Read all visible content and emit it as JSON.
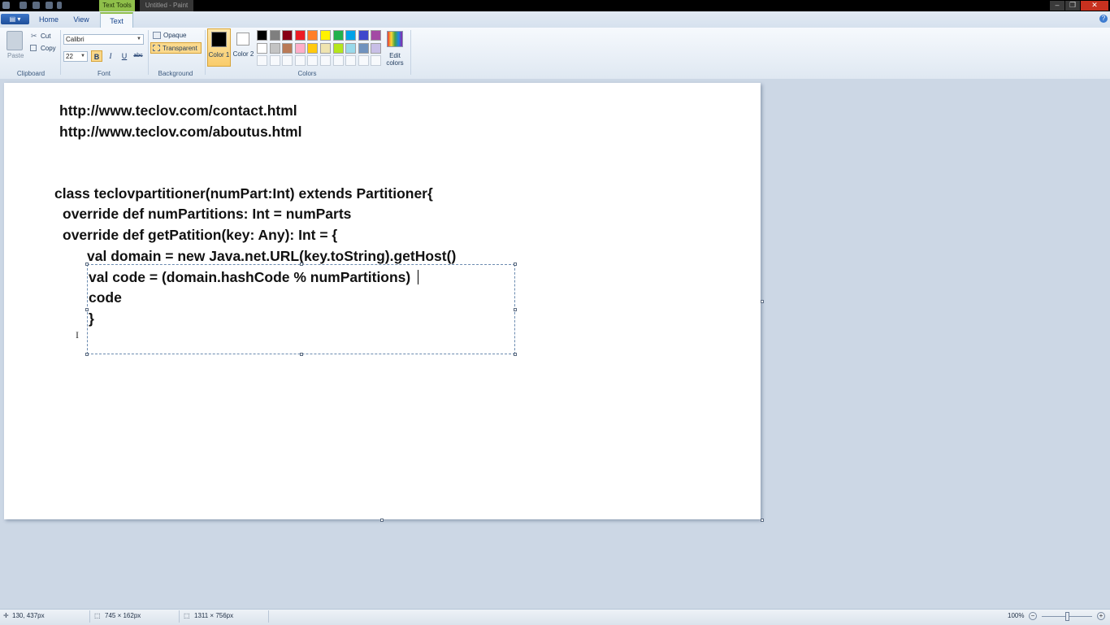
{
  "titlebar": {
    "contextual_tab": "Text Tools",
    "window_title": "Untitled - Paint",
    "minimize": "–",
    "maximize": "❐",
    "close": "✕"
  },
  "tabs": {
    "app_menu": "▤ ▾",
    "home": "Home",
    "view": "View",
    "text": "Text",
    "help": "?"
  },
  "clipboard": {
    "paste": "Paste",
    "cut": "Cut",
    "copy": "Copy",
    "group": "Clipboard"
  },
  "font": {
    "family": "Calibri",
    "size": "22",
    "bold": "B",
    "italic": "I",
    "underline": "U",
    "strikethrough": "abc",
    "group": "Font"
  },
  "background": {
    "opaque": "Opaque",
    "transparent": "Transparent",
    "group": "Background"
  },
  "colors": {
    "color1": "Color 1",
    "color1_value": "#000000",
    "color2": "Color 2",
    "color2_value": "#ffffff",
    "edit": "Edit colors",
    "group": "Colors",
    "palette_row1": [
      "#000000",
      "#7f7f7f",
      "#880015",
      "#ed1c24",
      "#ff7f27",
      "#fff200",
      "#22b14c",
      "#00a2e8",
      "#3f48cc",
      "#a349a4"
    ],
    "palette_row2": [
      "#ffffff",
      "#c3c3c3",
      "#b97a57",
      "#ffaec9",
      "#ffc90e",
      "#efe4b0",
      "#b5e61d",
      "#99d9ea",
      "#7092be",
      "#c8bfe7"
    ]
  },
  "canvas": {
    "lines": [
      "http://www.teclov.com/contact.html",
      "http://www.teclov.com/aboutus.html",
      "class teclovpartitioner(numPart:Int) extends Partitioner{",
      "override def numPartitions: Int = numParts",
      "override def getPatition(key: Any): Int = {",
      "val domain = new Java.net.URL(key.toString).getHost()",
      "val code = (domain.hashCode % numPartitions)",
      "code",
      "}"
    ]
  },
  "status": {
    "cursor_pos": "130, 437px",
    "selection_size": "745 × 162px",
    "image_size": "1311 × 756px",
    "zoom": "100%",
    "zoom_out": "−",
    "zoom_in": "+"
  }
}
